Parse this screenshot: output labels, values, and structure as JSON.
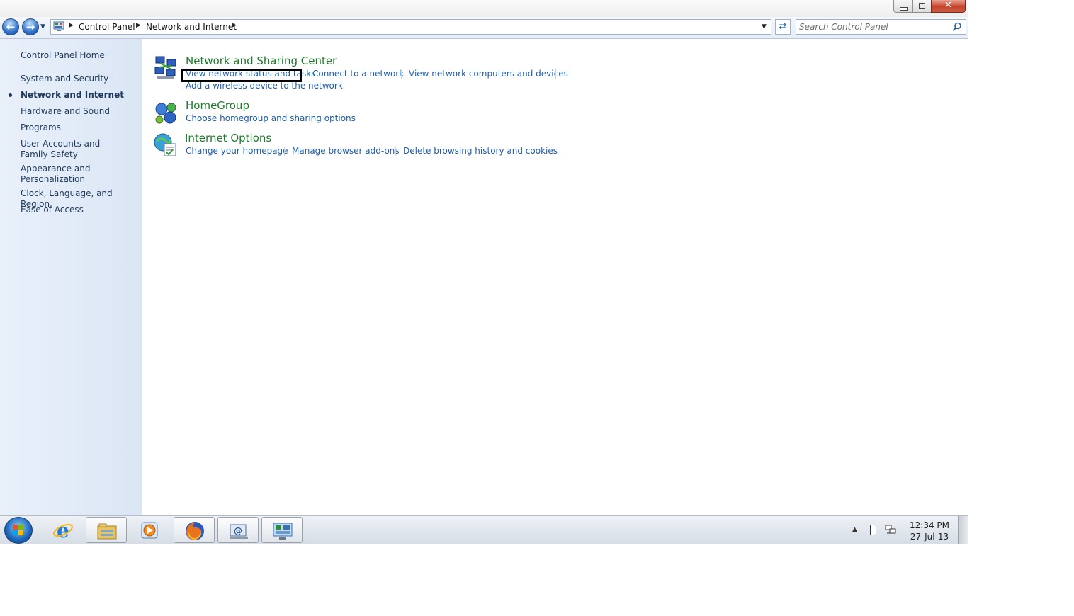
{
  "window": {
    "close_glyph": "✕"
  },
  "address_bar": {
    "breadcrumbs": [
      "Control Panel",
      "Network and Internet"
    ],
    "search_placeholder": "Search Control Panel"
  },
  "left_pane": {
    "home": "Control Panel Home",
    "items": [
      "System and Security",
      "Network and Internet",
      "Hardware and Sound",
      "Programs",
      "User Accounts and Family Safety",
      "Appearance and Personalization",
      "Clock, Language, and Region",
      "Ease of Access"
    ],
    "current_index": 1
  },
  "categories": [
    {
      "title": "Network and Sharing Center",
      "icon": "network-sharing-icon",
      "tasks": [
        "View network status and tasks",
        "Connect to a network",
        "View network computers and devices",
        "Add a wireless device to the network"
      ]
    },
    {
      "title": "HomeGroup",
      "icon": "homegroup-icon",
      "tasks": [
        "Choose homegroup and sharing options"
      ]
    },
    {
      "title": "Internet Options",
      "icon": "internet-options-icon",
      "tasks": [
        "Change your homepage",
        "Manage browser add-ons",
        "Delete browsing history and cookies"
      ]
    }
  ],
  "taskbar": {
    "pinned": [
      "internet-explorer-icon",
      "windows-explorer-icon",
      "media-player-icon",
      "firefox-icon",
      "mail-icon",
      "control-panel-icon"
    ],
    "clock_time": "12:34 PM",
    "clock_date": "27-Jul-13"
  },
  "colors": {
    "category_title": "#1e7a2b",
    "task_link": "#1f5ea8",
    "left_pane_text": "#1e395b"
  }
}
